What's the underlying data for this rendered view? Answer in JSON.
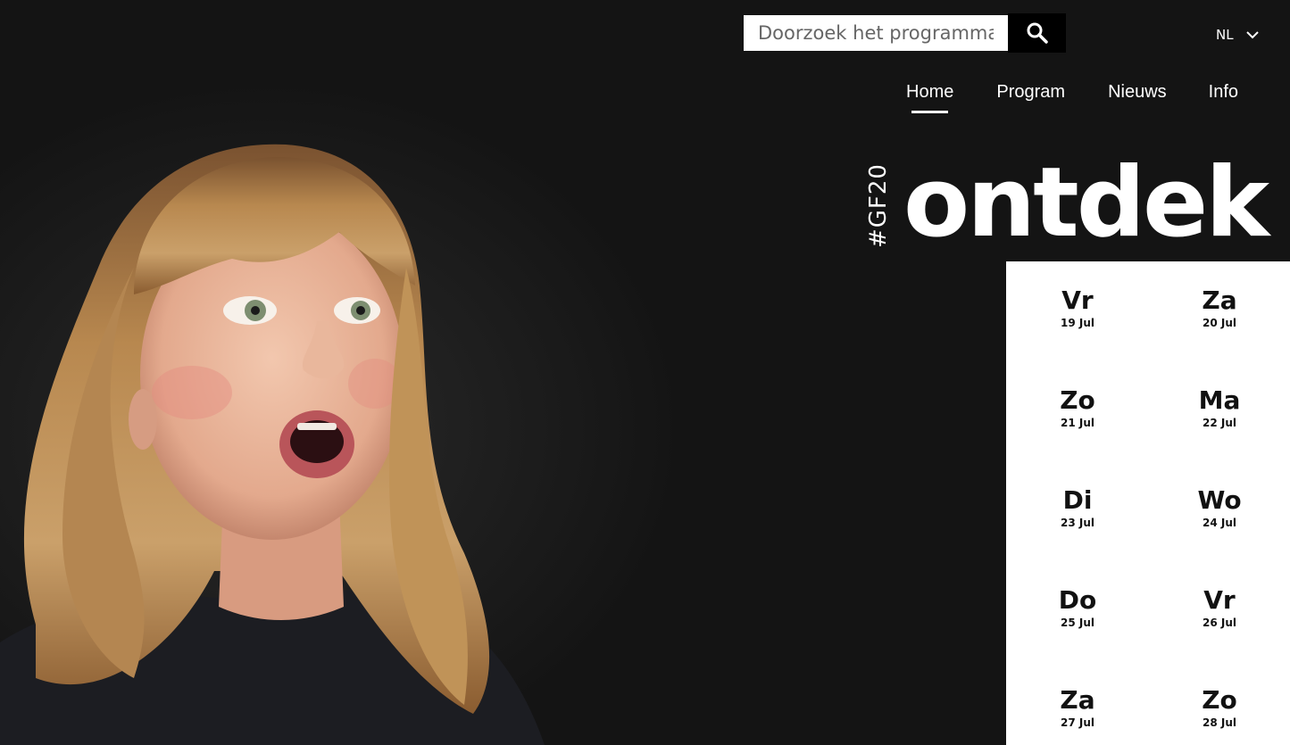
{
  "search": {
    "placeholder": "Doorzoek het programma..",
    "icon": "search-icon"
  },
  "language": {
    "current": "NL",
    "icon": "chevron-down-icon"
  },
  "nav": [
    {
      "label": "Home",
      "active": true
    },
    {
      "label": "Program",
      "active": false
    },
    {
      "label": "Nieuws",
      "active": false
    },
    {
      "label": "Info",
      "active": false
    }
  ],
  "brand": {
    "hashtag": "#GF20",
    "title": "ontdek"
  },
  "days": [
    {
      "name": "Vr",
      "date": "19 Jul"
    },
    {
      "name": "Za",
      "date": "20 Jul"
    },
    {
      "name": "Zo",
      "date": "21 Jul"
    },
    {
      "name": "Ma",
      "date": "22 Jul"
    },
    {
      "name": "Di",
      "date": "23 Jul"
    },
    {
      "name": "Wo",
      "date": "24 Jul"
    },
    {
      "name": "Do",
      "date": "25 Jul"
    },
    {
      "name": "Vr",
      "date": "26 Jul"
    },
    {
      "name": "Za",
      "date": "27 Jul"
    },
    {
      "name": "Zo",
      "date": "28 Jul"
    }
  ],
  "colors": {
    "background": "#141414",
    "panel": "#ffffff",
    "text_light": "#ffffff",
    "text_dark": "#111111"
  }
}
